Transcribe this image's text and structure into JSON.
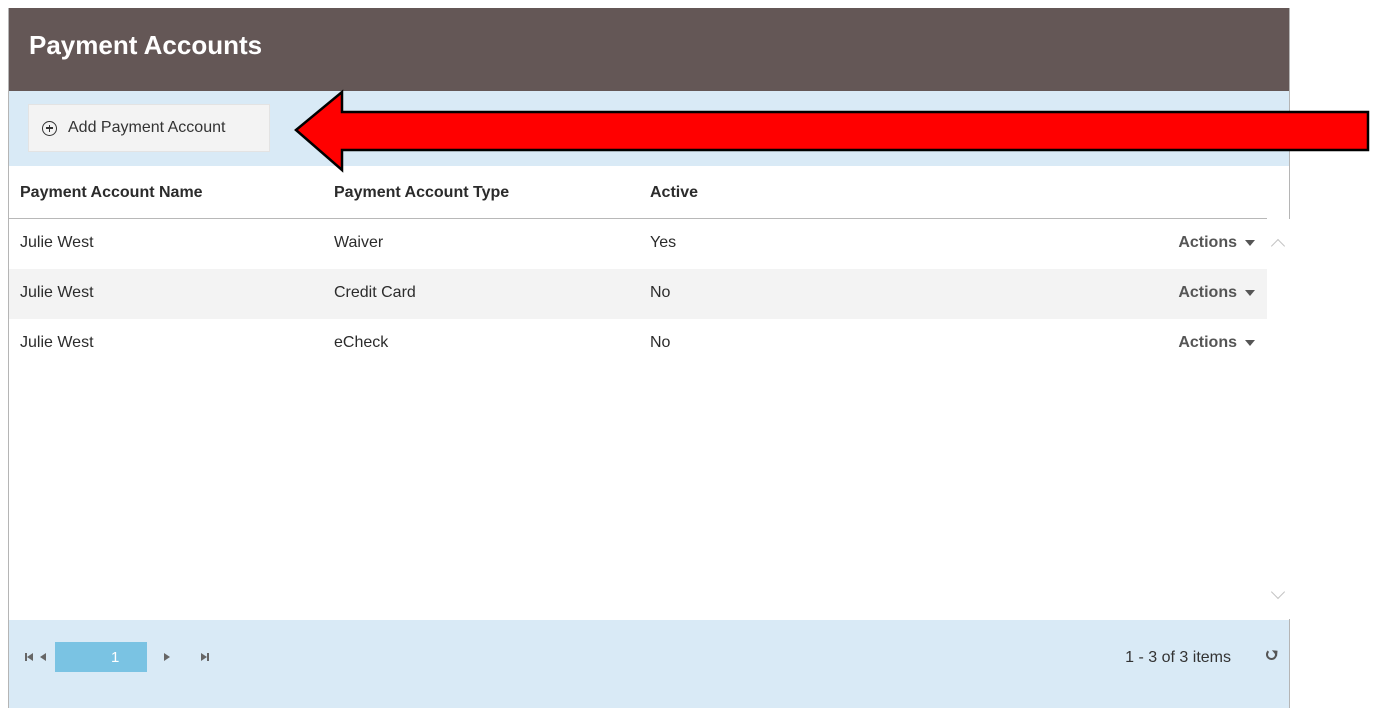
{
  "panel": {
    "title": "Payment Accounts"
  },
  "toolbar": {
    "add_button_label": "Add Payment Account",
    "add_button_icon": "plus-circle-icon"
  },
  "grid": {
    "columns": [
      "Payment Account Name",
      "Payment Account Type",
      "Active"
    ],
    "rows": [
      {
        "name": "Julie West",
        "type": "Waiver",
        "active": "Yes",
        "actions": "Actions"
      },
      {
        "name": "Julie West",
        "type": "Credit Card",
        "active": "No",
        "actions": "Actions"
      },
      {
        "name": "Julie West",
        "type": "eCheck",
        "active": "No",
        "actions": "Actions"
      }
    ]
  },
  "pager": {
    "current_page": "1",
    "info": "1 - 3 of 3 items"
  },
  "colors": {
    "header_bg": "#645756",
    "toolbar_bg": "#d9eaf6",
    "page_active": "#7ac3e3",
    "annotation_arrow": "#ff0000"
  }
}
